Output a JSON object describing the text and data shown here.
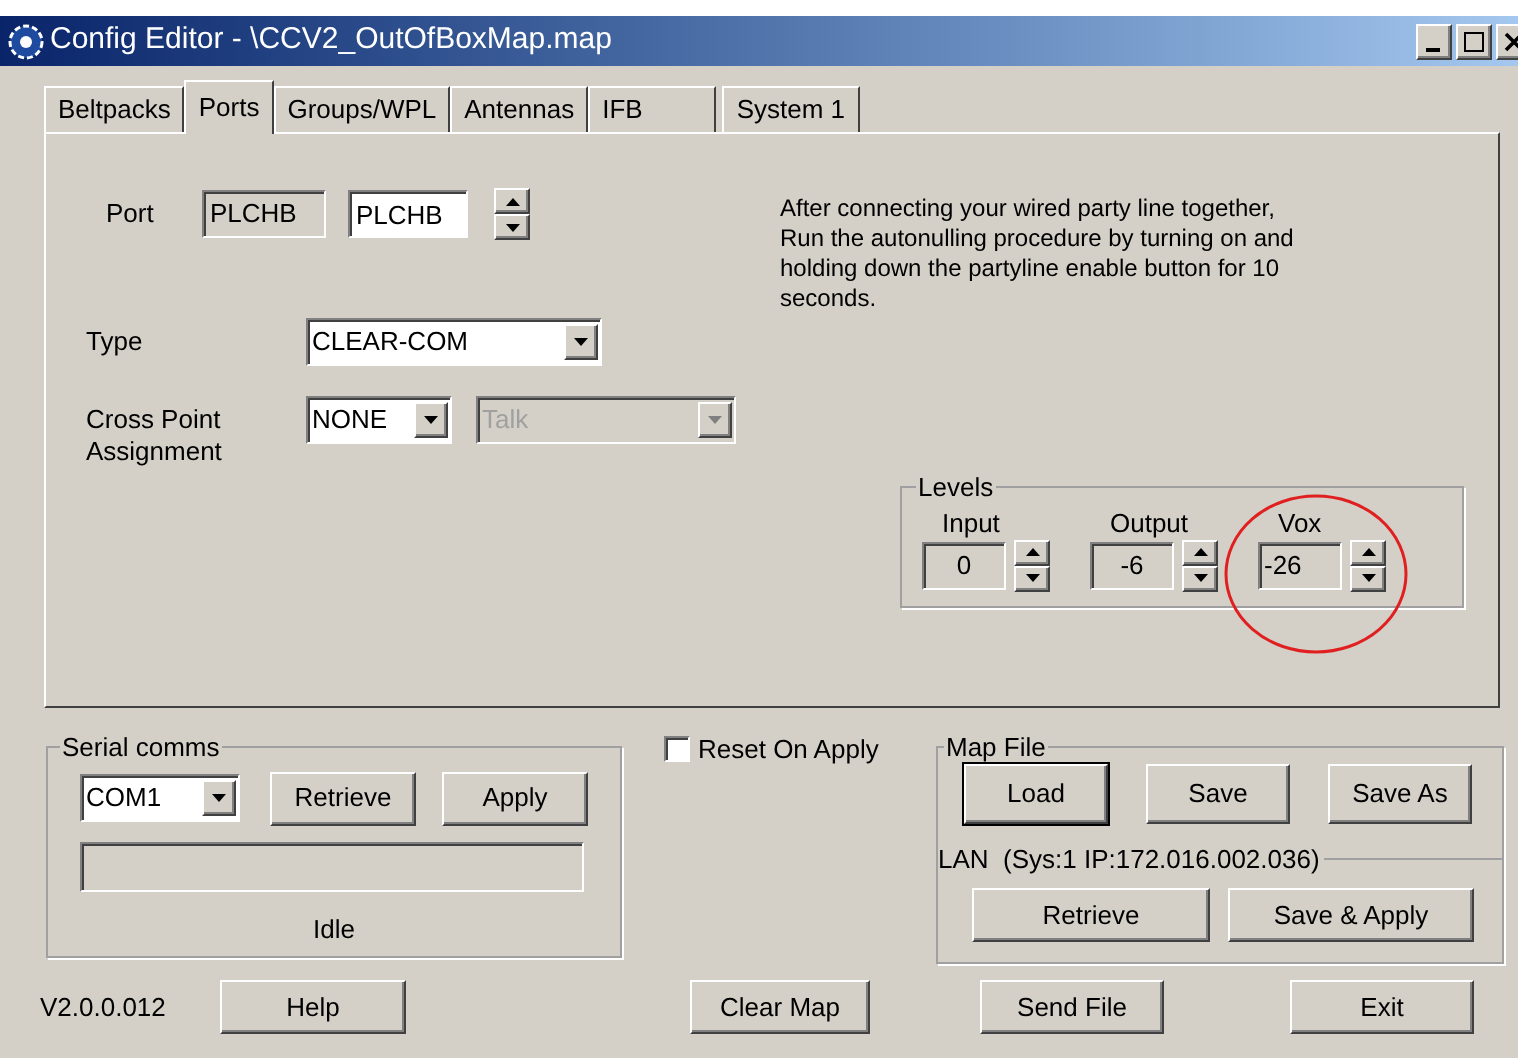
{
  "window": {
    "title": "Config Editor - \\CCV2_OutOfBoxMap.map"
  },
  "tabs": [
    {
      "label": "Beltpacks",
      "selected": false
    },
    {
      "label": "Ports",
      "selected": true
    },
    {
      "label": "Groups/WPL",
      "selected": false
    },
    {
      "label": "Antennas",
      "selected": false
    },
    {
      "label": "IFB",
      "selected": false
    },
    {
      "label": "System 1",
      "selected": false
    }
  ],
  "port": {
    "label": "Port",
    "readonly_value": "PLCHB",
    "value": "PLCHB"
  },
  "info_text": "After connecting your wired party line together, Run the autonulling procedure by turning on and holding down the partyline enable button for 10 seconds.",
  "type": {
    "label": "Type",
    "value": "CLEAR-COM"
  },
  "cross_point": {
    "label": "Cross Point Assignment",
    "value": "NONE",
    "mode": {
      "value": "Talk",
      "disabled": true
    }
  },
  "levels": {
    "title": "Levels",
    "fields": [
      {
        "label": "Input",
        "value": "0"
      },
      {
        "label": "Output",
        "value": "-6"
      },
      {
        "label": "Vox",
        "value": "-26"
      }
    ]
  },
  "serial": {
    "title": "Serial comms",
    "port": "COM1",
    "buttons": [
      "Retrieve",
      "Apply"
    ],
    "status": "Idle"
  },
  "reset_on_apply": {
    "label": "Reset On Apply",
    "checked": false
  },
  "map_file": {
    "title": "Map File",
    "buttons": [
      {
        "label": "Load",
        "default": true
      },
      {
        "label": "Save",
        "default": false
      },
      {
        "label": "Save As",
        "default": false
      }
    ],
    "lan": {
      "title": "LAN  (Sys:1 IP:172.016.002.036)",
      "buttons": [
        "Retrieve",
        "Save & Apply"
      ]
    }
  },
  "footer": {
    "version": "V2.0.0.012",
    "buttons": [
      "Help",
      "Clear Map",
      "Send File",
      "Exit"
    ]
  }
}
